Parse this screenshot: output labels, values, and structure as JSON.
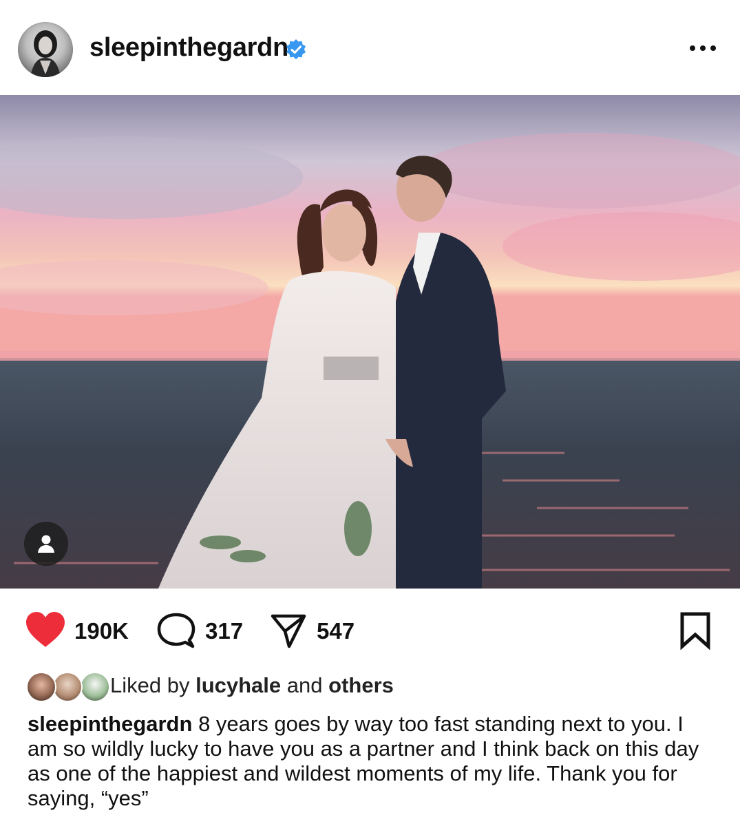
{
  "post": {
    "username": "sleepinthegardn",
    "verified": true,
    "more_icon": "more-horizontal-icon"
  },
  "actions": {
    "likes": "190K",
    "comments": "317",
    "shares": "547"
  },
  "liked_by": {
    "prefix": "Liked by",
    "user": "lucyhale",
    "connector": "and",
    "others": "others"
  },
  "caption": {
    "username": "sleepinthegardn",
    "text": "8 years goes by way too fast standing next to you. I am so wildly lucky to have you as a partner and I think back on this day as one of the happiest and wildest moments of my life. Thank you for saying, “yes”"
  },
  "colors": {
    "heart": "#ed2e3a",
    "verified": "#3897f0",
    "text": "#111111"
  }
}
